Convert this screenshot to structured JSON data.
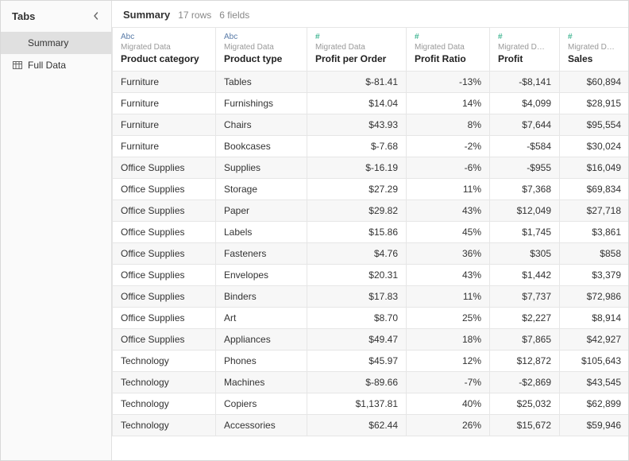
{
  "sidebar": {
    "title": "Tabs",
    "items": [
      {
        "label": "Summary",
        "icon": "",
        "active": true
      },
      {
        "label": "Full Data",
        "icon": "table",
        "active": false
      }
    ]
  },
  "header": {
    "title": "Summary",
    "rows_label": "17 rows",
    "fields_label": "6 fields"
  },
  "columns": [
    {
      "type_glyph": "Abc",
      "type_class": "text",
      "source": "Migrated Data",
      "name": "Product category",
      "align": "left"
    },
    {
      "type_glyph": "Abc",
      "type_class": "text",
      "source": "Migrated Data",
      "name": "Product type",
      "align": "left"
    },
    {
      "type_glyph": "#",
      "type_class": "num",
      "source": "Migrated Data",
      "name": "Profit per Order",
      "align": "right"
    },
    {
      "type_glyph": "#",
      "type_class": "num",
      "source": "Migrated Data",
      "name": "Profit Ratio",
      "align": "right"
    },
    {
      "type_glyph": "#",
      "type_class": "num",
      "source": "Migrated D…",
      "name": "Profit",
      "align": "right"
    },
    {
      "type_glyph": "#",
      "type_class": "num",
      "source": "Migrated D…",
      "name": "Sales",
      "align": "right"
    }
  ],
  "rows": [
    [
      "Furniture",
      "Tables",
      "$-81.41",
      "-13%",
      "-$8,141",
      "$60,894"
    ],
    [
      "Furniture",
      "Furnishings",
      "$14.04",
      "14%",
      "$4,099",
      "$28,915"
    ],
    [
      "Furniture",
      "Chairs",
      "$43.93",
      "8%",
      "$7,644",
      "$95,554"
    ],
    [
      "Furniture",
      "Bookcases",
      "$-7.68",
      "-2%",
      "-$584",
      "$30,024"
    ],
    [
      "Office Supplies",
      "Supplies",
      "$-16.19",
      "-6%",
      "-$955",
      "$16,049"
    ],
    [
      "Office Supplies",
      "Storage",
      "$27.29",
      "11%",
      "$7,368",
      "$69,834"
    ],
    [
      "Office Supplies",
      "Paper",
      "$29.82",
      "43%",
      "$12,049",
      "$27,718"
    ],
    [
      "Office Supplies",
      "Labels",
      "$15.86",
      "45%",
      "$1,745",
      "$3,861"
    ],
    [
      "Office Supplies",
      "Fasteners",
      "$4.76",
      "36%",
      "$305",
      "$858"
    ],
    [
      "Office Supplies",
      "Envelopes",
      "$20.31",
      "43%",
      "$1,442",
      "$3,379"
    ],
    [
      "Office Supplies",
      "Binders",
      "$17.83",
      "11%",
      "$7,737",
      "$72,986"
    ],
    [
      "Office Supplies",
      "Art",
      "$8.70",
      "25%",
      "$2,227",
      "$8,914"
    ],
    [
      "Office Supplies",
      "Appliances",
      "$49.47",
      "18%",
      "$7,865",
      "$42,927"
    ],
    [
      "Technology",
      "Phones",
      "$45.97",
      "12%",
      "$12,872",
      "$105,643"
    ],
    [
      "Technology",
      "Machines",
      "$-89.66",
      "-7%",
      "-$2,869",
      "$43,545"
    ],
    [
      "Technology",
      "Copiers",
      "$1,137.81",
      "40%",
      "$25,032",
      "$62,899"
    ],
    [
      "Technology",
      "Accessories",
      "$62.44",
      "26%",
      "$15,672",
      "$59,946"
    ]
  ]
}
